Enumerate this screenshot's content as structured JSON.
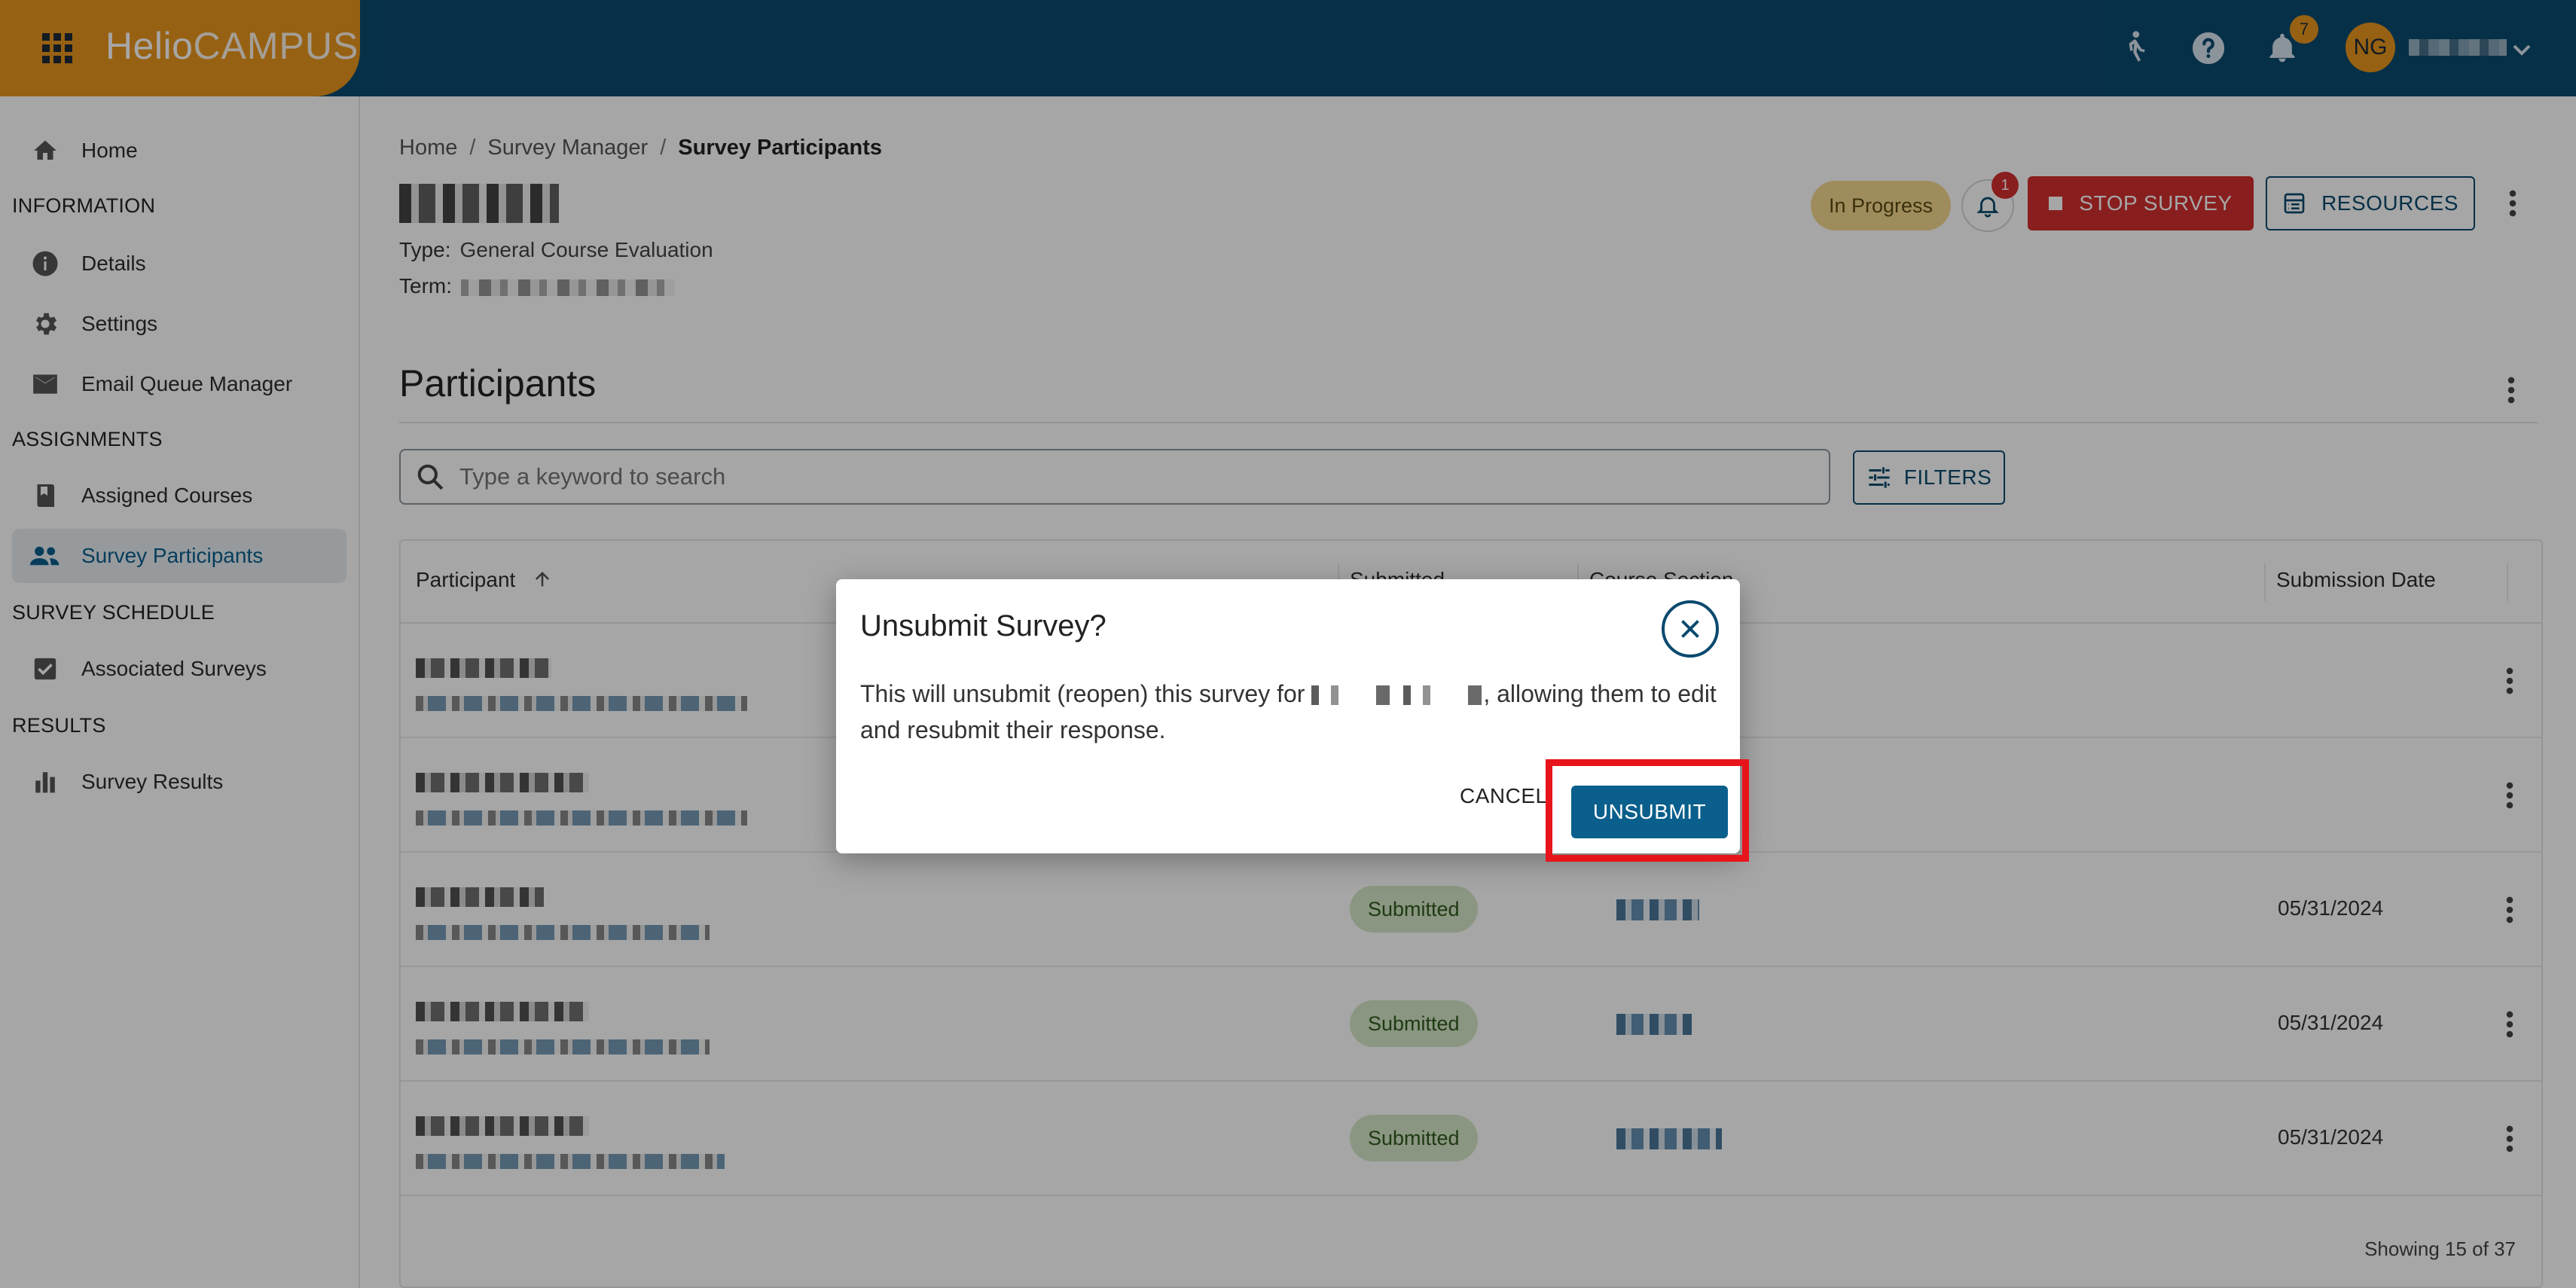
{
  "app": {
    "logo_primary": "Helio",
    "logo_secondary": "CAMPUS",
    "notification_count": "7",
    "user_initials": "NG"
  },
  "sidebar": {
    "home": "Home",
    "sections": {
      "information": "INFORMATION",
      "assignments": "ASSIGNMENTS",
      "survey_schedule": "SURVEY SCHEDULE",
      "results": "RESULTS"
    },
    "items": {
      "details": "Details",
      "settings": "Settings",
      "email_queue": "Email Queue Manager",
      "assigned_courses": "Assigned Courses",
      "survey_participants": "Survey Participants",
      "associated_surveys": "Associated Surveys",
      "survey_results": "Survey Results"
    },
    "active_item": "survey_participants"
  },
  "breadcrumb": [
    "Home",
    "Survey Manager",
    "Survey Participants"
  ],
  "survey": {
    "type_label": "Type:",
    "type_value": "General Course Evaluation",
    "term_label": "Term:",
    "status": "In Progress",
    "alert_count": "1",
    "stop_label": "STOP SURVEY",
    "resources_label": "RESOURCES"
  },
  "participants": {
    "title": "Participants",
    "search_placeholder": "Type a keyword to search",
    "filters_label": "FILTERS",
    "columns": {
      "participant": "Participant",
      "submitted": "Submitted",
      "course_section": "Course Section",
      "submission_date": "Submission Date"
    },
    "rows": [
      {
        "status": "",
        "date": ""
      },
      {
        "status": "",
        "date": ""
      },
      {
        "status": "Submitted",
        "date": "05/31/2024"
      },
      {
        "status": "Submitted",
        "date": "05/31/2024"
      },
      {
        "status": "Submitted",
        "date": "05/31/2024"
      }
    ],
    "footer": "Showing 15 of 37"
  },
  "dialog": {
    "title": "Unsubmit Survey?",
    "body_before": "This will unsubmit (reopen) this survey for ",
    "body_after": ", allowing them to edit and resubmit their response.",
    "cancel_label": "CANCEL",
    "confirm_label": "UNSUBMIT"
  },
  "colors": {
    "topbar": "#0a4a6e",
    "brand_orange": "#e8961e",
    "danger": "#d32f2f",
    "primary": "#0a5f8c",
    "highlight": "#e8141b"
  }
}
